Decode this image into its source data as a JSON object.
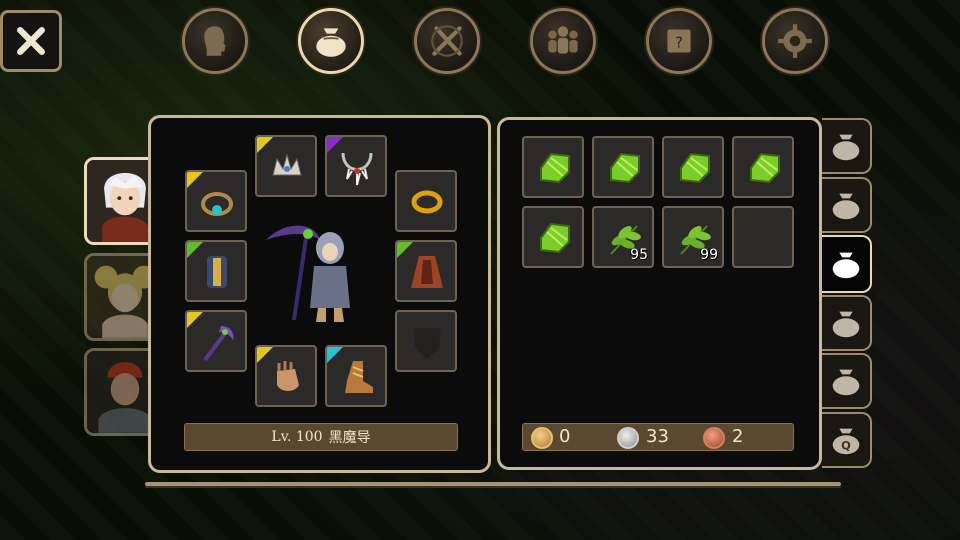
{
  "top_menu": [
    {
      "id": "profile",
      "icon": "head-silhouette-icon",
      "active": false
    },
    {
      "id": "bag",
      "icon": "bag-icon",
      "active": true
    },
    {
      "id": "skills",
      "icon": "crossed-swords-icon",
      "active": false
    },
    {
      "id": "party",
      "icon": "party-icon",
      "active": false
    },
    {
      "id": "quest",
      "icon": "scroll-icon",
      "active": false
    },
    {
      "id": "settings",
      "icon": "gear-icon",
      "active": false
    }
  ],
  "characters": [
    {
      "name": "white-hair-hero",
      "active": true
    },
    {
      "name": "blonde-girl",
      "active": false
    },
    {
      "name": "red-hair-warrior",
      "active": false
    }
  ],
  "equipment": {
    "level_prefix": "Lv. 100",
    "class_name": "黑魔导",
    "slots": [
      {
        "slot": "helmet",
        "item": "crown",
        "rarity": "yellow"
      },
      {
        "slot": "necklace",
        "item": "fang-necklace",
        "rarity": "purple"
      },
      {
        "slot": "amulet",
        "item": "gem-ring",
        "rarity": "yellow"
      },
      {
        "slot": "ring",
        "item": "gold-ring",
        "rarity": "none"
      },
      {
        "slot": "armor",
        "item": "robe-armor",
        "rarity": "green"
      },
      {
        "slot": "cape",
        "item": "cloak",
        "rarity": "green"
      },
      {
        "slot": "weapon",
        "item": "scythe",
        "rarity": "yellow"
      },
      {
        "slot": "offhand",
        "item": "empty-shield",
        "rarity": "none"
      },
      {
        "slot": "gloves",
        "item": "gauntlet",
        "rarity": "yellow"
      },
      {
        "slot": "boots",
        "item": "boot",
        "rarity": "cyan"
      }
    ]
  },
  "inventory": {
    "items": [
      {
        "item": "green-gem",
        "qty": ""
      },
      {
        "item": "green-gem",
        "qty": ""
      },
      {
        "item": "green-gem",
        "qty": ""
      },
      {
        "item": "green-gem",
        "qty": ""
      },
      {
        "item": "green-gem",
        "qty": ""
      },
      {
        "item": "green-leaf",
        "qty": "95"
      },
      {
        "item": "green-leaf",
        "qty": "99"
      },
      {
        "item": "",
        "qty": ""
      }
    ],
    "currency": {
      "gold": "0",
      "silver": "33",
      "copper": "2"
    }
  },
  "bag_tabs": [
    {
      "label": "",
      "active": false
    },
    {
      "label": "",
      "active": false
    },
    {
      "label": "",
      "active": true
    },
    {
      "label": "",
      "active": false
    },
    {
      "label": "",
      "active": false
    },
    {
      "label": "Q",
      "active": false
    }
  ],
  "colors": {
    "rarity_yellow": "#e0c81e",
    "rarity_purple": "#8a2bd0",
    "rarity_green": "#5fbd2a",
    "rarity_cyan": "#2ac0d8",
    "panel_border": "#c8b898"
  }
}
